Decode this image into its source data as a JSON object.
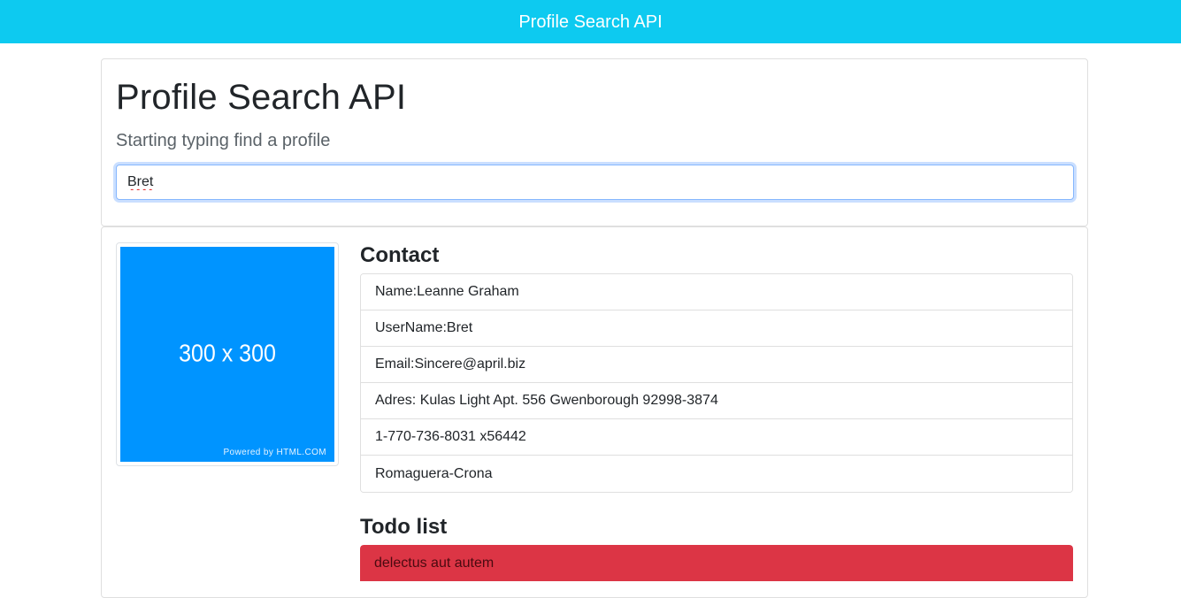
{
  "navbar": {
    "brand": "Profile Search API"
  },
  "search": {
    "title": "Profile Search API",
    "subtitle": "Starting typing find a profile",
    "input_value": "Bret"
  },
  "profile": {
    "avatar": {
      "dims_text": "300 x 300",
      "powered_text": "Powered by HTML.COM",
      "color": "#0094ff"
    },
    "contact_title": "Contact",
    "contact_items": [
      "Name:Leanne Graham",
      "UserName:Bret",
      "Email:Sincere@april.biz",
      "Adres: Kulas Light Apt. 556 Gwenborough 92998-3874",
      "1-770-736-8031 x56442",
      "Romaguera-Crona"
    ],
    "todo_title": "Todo list",
    "todos": [
      {
        "text": "delectus aut autem",
        "status_color": "#dc3545"
      }
    ]
  },
  "colors": {
    "navbar": "#0dcaf0",
    "todo_incomplete": "#dc3545"
  }
}
